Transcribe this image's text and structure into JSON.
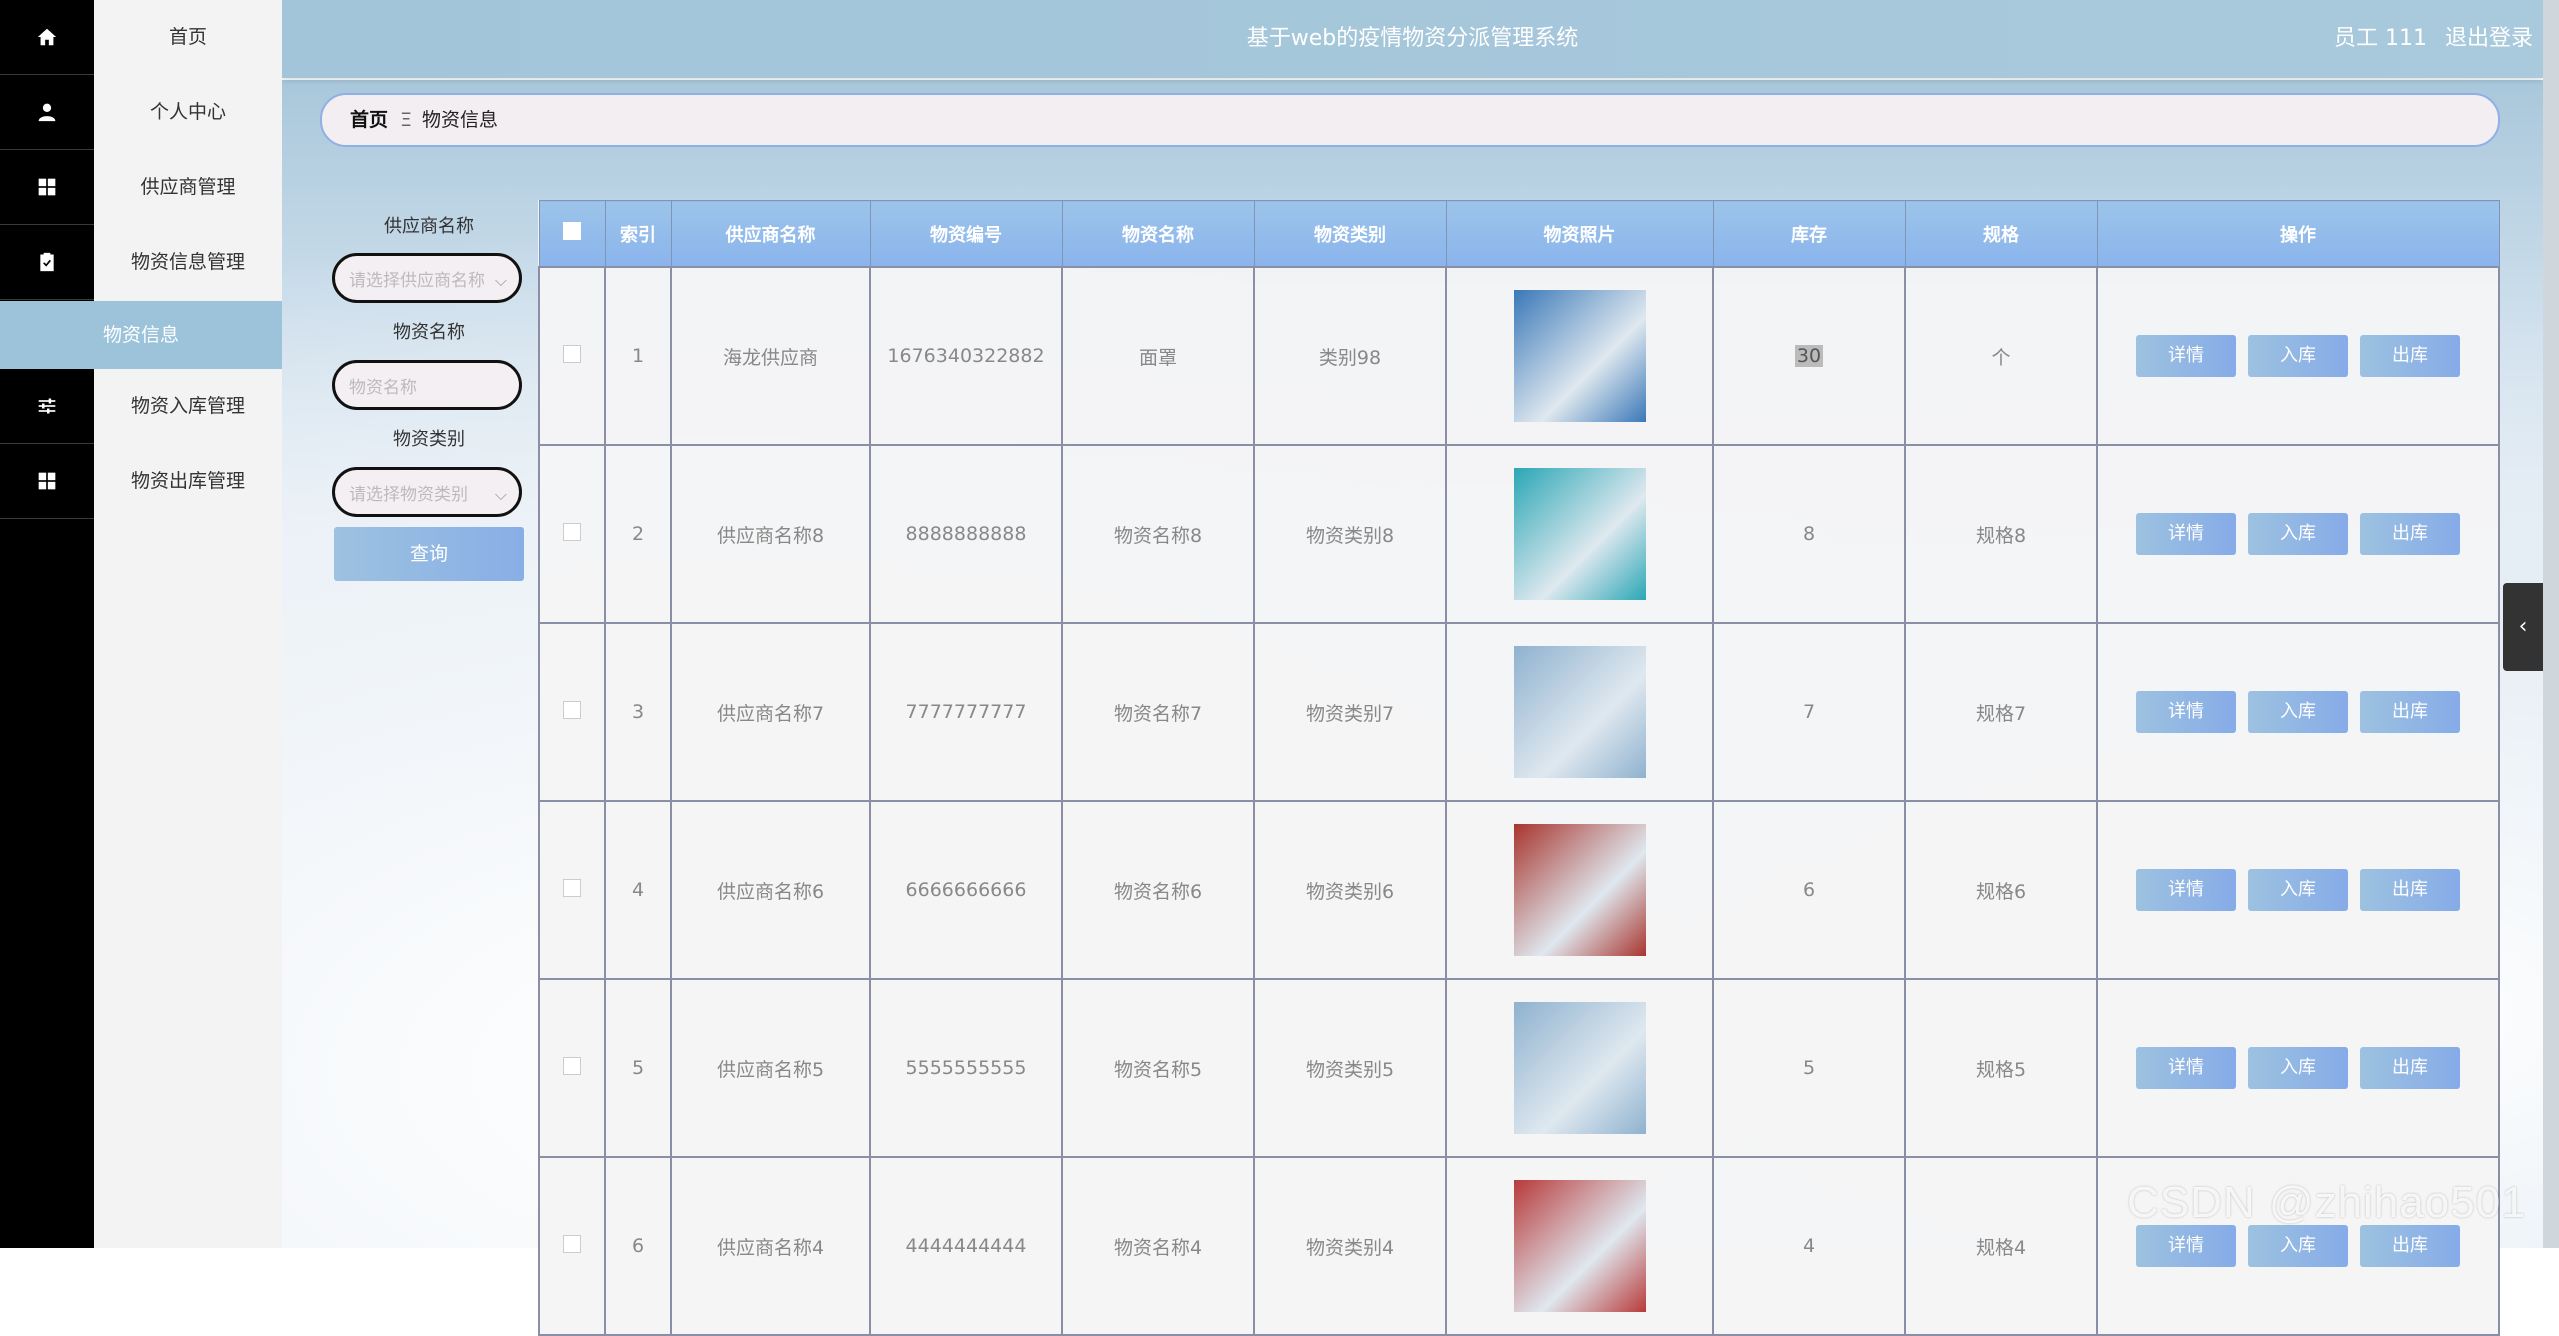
{
  "app": {
    "title": "基于web的疫情物资分派管理系统",
    "user_label": "员工 111",
    "logout_label": "退出登录"
  },
  "sidebar": {
    "items": [
      {
        "label": "首页",
        "icon": "home-icon"
      },
      {
        "label": "个人中心",
        "icon": "user-icon"
      },
      {
        "label": "供应商管理",
        "icon": "grid-icon"
      },
      {
        "label": "物资信息管理",
        "icon": "clipboard-icon"
      },
      {
        "label": "物资入库管理",
        "icon": "sliders-icon"
      },
      {
        "label": "物资出库管理",
        "icon": "grid-icon"
      }
    ],
    "active_sub": "物资信息"
  },
  "breadcrumb": {
    "home": "首页",
    "separator": "Ξ",
    "current": "物资信息"
  },
  "search": {
    "supplier_label": "供应商名称",
    "supplier_placeholder": "请选择供应商名称",
    "name_label": "物资名称",
    "name_placeholder": "物资名称",
    "category_label": "物资类别",
    "category_placeholder": "请选择物资类别",
    "query_button": "查询"
  },
  "table": {
    "headers": [
      "索引",
      "供应商名称",
      "物资编号",
      "物资名称",
      "物资类别",
      "物资照片",
      "库存",
      "规格",
      "操作"
    ],
    "rows": [
      {
        "index": "1",
        "supplier": "海龙供应商",
        "code": "1676340322882",
        "name": "面罩",
        "category": "类别98",
        "stock": "30",
        "spec": "个",
        "pic_color": "#3a78b8"
      },
      {
        "index": "2",
        "supplier": "供应商名称8",
        "code": "8888888888",
        "name": "物资名称8",
        "category": "物资类别8",
        "stock": "8",
        "spec": "规格8",
        "pic_color": "#2aa7b5"
      },
      {
        "index": "3",
        "supplier": "供应商名称7",
        "code": "7777777777",
        "name": "物资名称7",
        "category": "物资类别7",
        "stock": "7",
        "spec": "规格7",
        "pic_color": "#8fb2cf"
      },
      {
        "index": "4",
        "supplier": "供应商名称6",
        "code": "6666666666",
        "name": "物资名称6",
        "category": "物资类别6",
        "stock": "6",
        "spec": "规格6",
        "pic_color": "#a8352e"
      },
      {
        "index": "5",
        "supplier": "供应商名称5",
        "code": "5555555555",
        "name": "物资名称5",
        "category": "物资类别5",
        "stock": "5",
        "spec": "规格5",
        "pic_color": "#8fb2cf"
      },
      {
        "index": "6",
        "supplier": "供应商名称4",
        "code": "4444444444",
        "name": "物资名称4",
        "category": "物资类别4",
        "stock": "4",
        "spec": "规格4",
        "pic_color": "#b83a3a"
      }
    ],
    "actions": {
      "detail": "详情",
      "in": "入库",
      "out": "出库"
    }
  },
  "watermark": "CSDN @zhihao501"
}
